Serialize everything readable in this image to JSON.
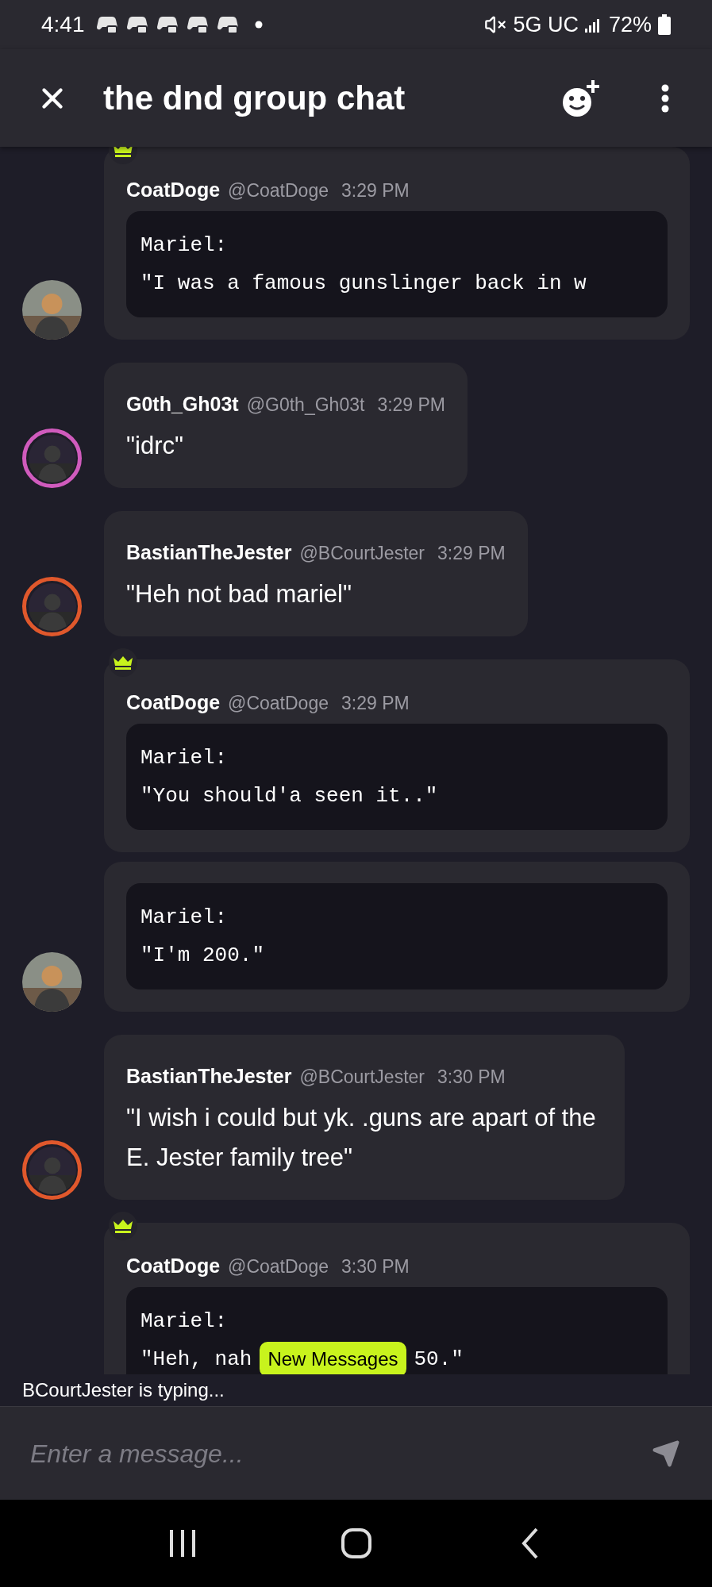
{
  "status_bar": {
    "time": "4:41",
    "network": "5G UC",
    "battery": "72%"
  },
  "header": {
    "title": "the dnd group chat"
  },
  "groups": [
    {
      "avatar_shown": true,
      "crown": true,
      "author": "CoatDoge",
      "handle": "@CoatDoge",
      "time": "3:29 PM",
      "cards": [
        {
          "kind": "code",
          "lines": [
            "Mariel:",
            "\"I was a famous gunslinger back in w"
          ]
        }
      ]
    },
    {
      "avatar_shown": true,
      "color": "#d05bbd",
      "crown": false,
      "author": "G0th_Gh03t",
      "handle": "@G0th_Gh03t",
      "time": "3:29 PM",
      "cards": [
        {
          "kind": "text",
          "text": "\"idrc\""
        }
      ]
    },
    {
      "avatar_shown": true,
      "color": "#e0582c",
      "crown": false,
      "author": "BastianTheJester",
      "handle": "@BCourtJester",
      "time": "3:29 PM",
      "cards": [
        {
          "kind": "text",
          "text": "\"Heh not bad mariel\""
        }
      ]
    },
    {
      "avatar_shown": true,
      "crown": true,
      "author": "CoatDoge",
      "handle": "@CoatDoge",
      "time": "3:29 PM",
      "cards": [
        {
          "kind": "code",
          "lines": [
            "Mariel:",
            "\"You should'a seen it..\""
          ]
        },
        {
          "kind": "code",
          "lines": [
            "Mariel:",
            "\"I'm 200.\""
          ]
        }
      ]
    },
    {
      "avatar_shown": true,
      "color": "#e0582c",
      "crown": false,
      "author": "BastianTheJester",
      "handle": "@BCourtJester",
      "time": "3:30 PM",
      "cards": [
        {
          "kind": "text",
          "text": "\"I wish i could but yk. .guns are apart of the E. Jester family tree\""
        }
      ]
    },
    {
      "avatar_shown": false,
      "crown": true,
      "author": "CoatDoge",
      "handle": "@CoatDoge",
      "time": "3:30 PM",
      "cards": [
        {
          "kind": "code",
          "lines": [
            "Mariel:"
          ],
          "cut_line": [
            "\"Heh, nah",
            "50.\""
          ]
        }
      ]
    }
  ],
  "new_messages": "New Messages",
  "typing": "BCourtJester is typing...",
  "composer": {
    "placeholder": "Enter a message..."
  }
}
